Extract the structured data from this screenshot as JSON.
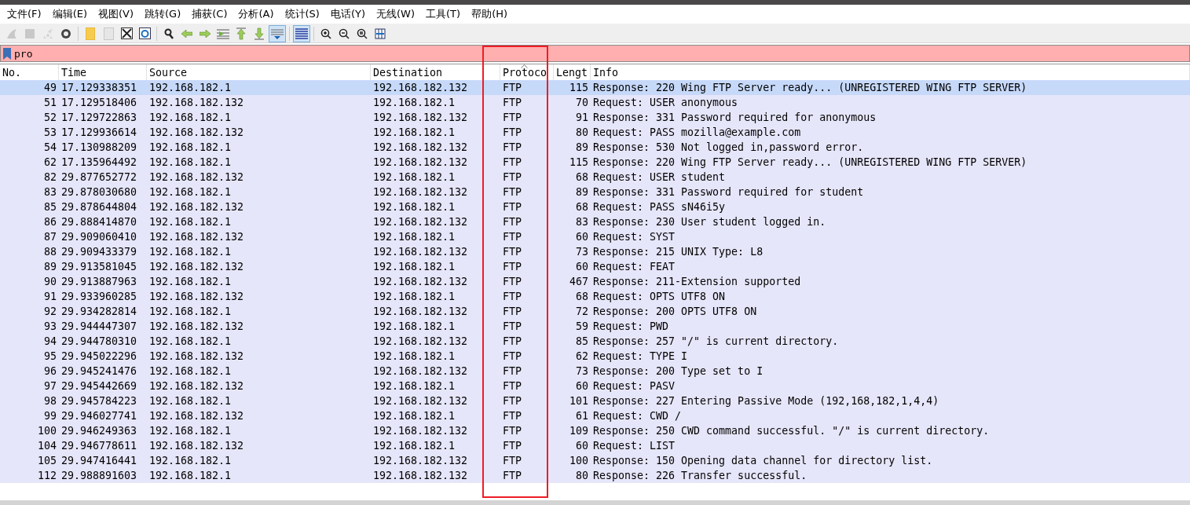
{
  "menu": [
    "文件(F)",
    "编辑(E)",
    "视图(V)",
    "跳转(G)",
    "捕获(C)",
    "分析(A)",
    "统计(S)",
    "电话(Y)",
    "无线(W)",
    "工具(T)",
    "帮助(H)"
  ],
  "toolbar": [
    {
      "kind": "fin",
      "disabled": true,
      "pressed": false
    },
    {
      "kind": "stop",
      "disabled": true,
      "pressed": false
    },
    {
      "kind": "restart",
      "disabled": true,
      "pressed": false
    },
    {
      "kind": "options",
      "disabled": false,
      "pressed": false
    },
    {
      "kind": "sep"
    },
    {
      "kind": "open",
      "disabled": false,
      "pressed": false
    },
    {
      "kind": "save",
      "disabled": true,
      "pressed": false
    },
    {
      "kind": "close",
      "disabled": false,
      "pressed": false
    },
    {
      "kind": "reload",
      "disabled": false,
      "pressed": false
    },
    {
      "kind": "sep"
    },
    {
      "kind": "find",
      "disabled": false,
      "pressed": false
    },
    {
      "kind": "back",
      "disabled": false,
      "pressed": false
    },
    {
      "kind": "forward",
      "disabled": false,
      "pressed": false
    },
    {
      "kind": "goto",
      "disabled": false,
      "pressed": false
    },
    {
      "kind": "first",
      "disabled": false,
      "pressed": false
    },
    {
      "kind": "last",
      "disabled": false,
      "pressed": false
    },
    {
      "kind": "autoscroll",
      "disabled": false,
      "pressed": true
    },
    {
      "kind": "sep"
    },
    {
      "kind": "colorize",
      "disabled": false,
      "pressed": true
    },
    {
      "kind": "sep"
    },
    {
      "kind": "zoomin",
      "disabled": false,
      "pressed": false
    },
    {
      "kind": "zoomout",
      "disabled": false,
      "pressed": false
    },
    {
      "kind": "zoomnormal",
      "disabled": false,
      "pressed": false
    },
    {
      "kind": "resize",
      "disabled": false,
      "pressed": false
    }
  ],
  "filter": {
    "value": "pro",
    "invalid": true
  },
  "table": {
    "columns": [
      {
        "label": "No.",
        "sorted": false
      },
      {
        "label": "Time",
        "sorted": false
      },
      {
        "label": "Source",
        "sorted": false
      },
      {
        "label": "Destination",
        "sorted": false
      },
      {
        "label": "Protoco",
        "sorted": true
      },
      {
        "label": "Lengt",
        "sorted": false
      },
      {
        "label": "Info",
        "sorted": false
      }
    ],
    "rows": [
      {
        "no": "49",
        "time": "17.129338351",
        "source": "192.168.182.1",
        "destination": "192.168.182.132",
        "protocol": "FTP",
        "length": "115",
        "info": "Response: 220 Wing FTP Server ready... (UNREGISTERED WING FTP SERVER)",
        "selected": true
      },
      {
        "no": "51",
        "time": "17.129518406",
        "source": "192.168.182.132",
        "destination": "192.168.182.1",
        "protocol": "FTP",
        "length": "70",
        "info": "Request: USER anonymous",
        "selected": false
      },
      {
        "no": "52",
        "time": "17.129722863",
        "source": "192.168.182.1",
        "destination": "192.168.182.132",
        "protocol": "FTP",
        "length": "91",
        "info": "Response: 331 Password required for anonymous",
        "selected": false
      },
      {
        "no": "53",
        "time": "17.129936614",
        "source": "192.168.182.132",
        "destination": "192.168.182.1",
        "protocol": "FTP",
        "length": "80",
        "info": "Request: PASS mozilla@example.com",
        "selected": false
      },
      {
        "no": "54",
        "time": "17.130988209",
        "source": "192.168.182.1",
        "destination": "192.168.182.132",
        "protocol": "FTP",
        "length": "89",
        "info": "Response: 530 Not logged in,password error.",
        "selected": false
      },
      {
        "no": "62",
        "time": "17.135964492",
        "source": "192.168.182.1",
        "destination": "192.168.182.132",
        "protocol": "FTP",
        "length": "115",
        "info": "Response: 220 Wing FTP Server ready... (UNREGISTERED WING FTP SERVER)",
        "selected": false
      },
      {
        "no": "82",
        "time": "29.877652772",
        "source": "192.168.182.132",
        "destination": "192.168.182.1",
        "protocol": "FTP",
        "length": "68",
        "info": "Request: USER student",
        "selected": false
      },
      {
        "no": "83",
        "time": "29.878030680",
        "source": "192.168.182.1",
        "destination": "192.168.182.132",
        "protocol": "FTP",
        "length": "89",
        "info": "Response: 331 Password required for student",
        "selected": false
      },
      {
        "no": "85",
        "time": "29.878644804",
        "source": "192.168.182.132",
        "destination": "192.168.182.1",
        "protocol": "FTP",
        "length": "68",
        "info": "Request: PASS sN46i5y",
        "selected": false
      },
      {
        "no": "86",
        "time": "29.888414870",
        "source": "192.168.182.1",
        "destination": "192.168.182.132",
        "protocol": "FTP",
        "length": "83",
        "info": "Response: 230 User student logged in.",
        "selected": false
      },
      {
        "no": "87",
        "time": "29.909060410",
        "source": "192.168.182.132",
        "destination": "192.168.182.1",
        "protocol": "FTP",
        "length": "60",
        "info": "Request: SYST",
        "selected": false
      },
      {
        "no": "88",
        "time": "29.909433379",
        "source": "192.168.182.1",
        "destination": "192.168.182.132",
        "protocol": "FTP",
        "length": "73",
        "info": "Response: 215 UNIX Type: L8",
        "selected": false
      },
      {
        "no": "89",
        "time": "29.913581045",
        "source": "192.168.182.132",
        "destination": "192.168.182.1",
        "protocol": "FTP",
        "length": "60",
        "info": "Request: FEAT",
        "selected": false
      },
      {
        "no": "90",
        "time": "29.913887963",
        "source": "192.168.182.1",
        "destination": "192.168.182.132",
        "protocol": "FTP",
        "length": "467",
        "info": "Response: 211-Extension supported",
        "selected": false
      },
      {
        "no": "91",
        "time": "29.933960285",
        "source": "192.168.182.132",
        "destination": "192.168.182.1",
        "protocol": "FTP",
        "length": "68",
        "info": "Request: OPTS UTF8 ON",
        "selected": false
      },
      {
        "no": "92",
        "time": "29.934282814",
        "source": "192.168.182.1",
        "destination": "192.168.182.132",
        "protocol": "FTP",
        "length": "72",
        "info": "Response: 200 OPTS UTF8 ON",
        "selected": false
      },
      {
        "no": "93",
        "time": "29.944447307",
        "source": "192.168.182.132",
        "destination": "192.168.182.1",
        "protocol": "FTP",
        "length": "59",
        "info": "Request: PWD",
        "selected": false
      },
      {
        "no": "94",
        "time": "29.944780310",
        "source": "192.168.182.1",
        "destination": "192.168.182.132",
        "protocol": "FTP",
        "length": "85",
        "info": "Response: 257 \"/\" is current directory.",
        "selected": false
      },
      {
        "no": "95",
        "time": "29.945022296",
        "source": "192.168.182.132",
        "destination": "192.168.182.1",
        "protocol": "FTP",
        "length": "62",
        "info": "Request: TYPE I",
        "selected": false
      },
      {
        "no": "96",
        "time": "29.945241476",
        "source": "192.168.182.1",
        "destination": "192.168.182.132",
        "protocol": "FTP",
        "length": "73",
        "info": "Response: 200 Type set to I",
        "selected": false
      },
      {
        "no": "97",
        "time": "29.945442669",
        "source": "192.168.182.132",
        "destination": "192.168.182.1",
        "protocol": "FTP",
        "length": "60",
        "info": "Request: PASV",
        "selected": false
      },
      {
        "no": "98",
        "time": "29.945784223",
        "source": "192.168.182.1",
        "destination": "192.168.182.132",
        "protocol": "FTP",
        "length": "101",
        "info": "Response: 227 Entering Passive Mode (192,168,182,1,4,4)",
        "selected": false
      },
      {
        "no": "99",
        "time": "29.946027741",
        "source": "192.168.182.132",
        "destination": "192.168.182.1",
        "protocol": "FTP",
        "length": "61",
        "info": "Request: CWD /",
        "selected": false
      },
      {
        "no": "100",
        "time": "29.946249363",
        "source": "192.168.182.1",
        "destination": "192.168.182.132",
        "protocol": "FTP",
        "length": "109",
        "info": "Response: 250 CWD command successful. \"/\" is current directory.",
        "selected": false
      },
      {
        "no": "104",
        "time": "29.946778611",
        "source": "192.168.182.132",
        "destination": "192.168.182.1",
        "protocol": "FTP",
        "length": "60",
        "info": "Request: LIST",
        "selected": false
      },
      {
        "no": "105",
        "time": "29.947416441",
        "source": "192.168.182.1",
        "destination": "192.168.182.132",
        "protocol": "FTP",
        "length": "100",
        "info": "Response: 150 Opening data channel for directory list.",
        "selected": false
      },
      {
        "no": "112",
        "time": "29.988891603",
        "source": "192.168.182.1",
        "destination": "192.168.182.132",
        "protocol": "FTP",
        "length": "80",
        "info": "Response: 226 Transfer successful.",
        "selected": false
      }
    ]
  }
}
